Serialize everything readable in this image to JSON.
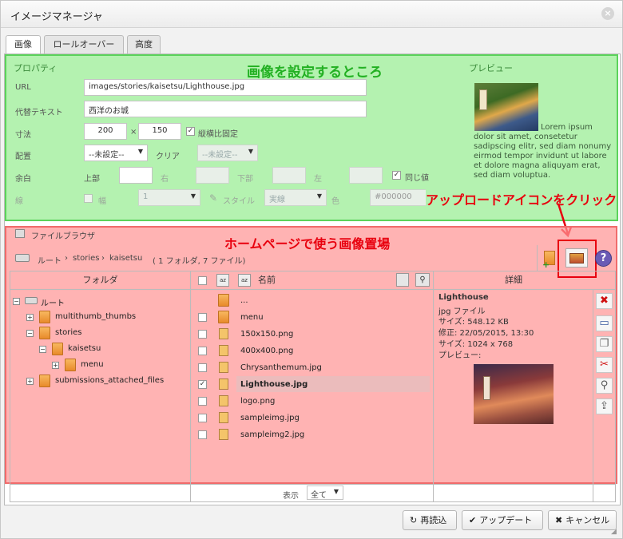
{
  "window": {
    "title": "イメージマネージャ",
    "close_glyph": "×"
  },
  "tabs": [
    {
      "label": "画像",
      "active": true
    },
    {
      "label": "ロールオーバー",
      "active": false
    },
    {
      "label": "高度",
      "active": false
    }
  ],
  "properties": {
    "section": "プロパティ",
    "url_label": "URL",
    "url_value": "images/stories/kaisetsu/Lighthouse.jpg",
    "alt_label": "代替テキスト",
    "alt_value": "西洋のお城",
    "size_label": "寸法",
    "width": "200",
    "times": "×",
    "height": "150",
    "keep_ratio_label": "縦横比固定",
    "keep_ratio_checked": true,
    "align_label": "配置",
    "align_value": "--未設定--",
    "clear_label": "クリア",
    "clear_value": "--未設定--",
    "margin_label": "余白",
    "margin_top": "上部",
    "margin_right": "右",
    "margin_bottom": "下部",
    "margin_left": "左",
    "same_value_label": "同じ値",
    "same_value_checked": true,
    "border_label": "線",
    "border_width_label": "幅",
    "border_width_value": "1",
    "border_style_label": "スタイル",
    "border_style_value": "実線",
    "border_color_label": "色",
    "border_color_value": "#000000"
  },
  "preview": {
    "section": "プレビュー",
    "text": "Lorem ipsum dolor sit amet, consetetur sadipscing elitr, sed diam nonumy eirmod tempor invidunt ut labore et dolore magna aliquyam erat, sed diam voluptua."
  },
  "annotations": {
    "green": "画像を設定するところ",
    "red": "ホームページで使う画像置場",
    "upload": "アップロードアイコンをクリック"
  },
  "browser": {
    "legend": "ファイルブラウザ",
    "breadcrumb_root": "ルート",
    "breadcrumb_sep": "›",
    "breadcrumb_1": "stories",
    "breadcrumb_2": "kaisetsu",
    "breadcrumb_count": "( 1 フォルダ, 7 ファイル)",
    "col_folder": "フォルダ",
    "col_name": "名前",
    "col_details": "詳細",
    "tree": [
      {
        "label": "ルート",
        "expander": "−"
      },
      {
        "label": "multithumb_thumbs",
        "expander": "+"
      },
      {
        "label": "stories",
        "expander": "−"
      },
      {
        "label": "kaisetsu",
        "expander": "−"
      },
      {
        "label": "menu",
        "expander": "+"
      },
      {
        "label": "submissions_attached_files",
        "expander": "+"
      }
    ],
    "files": [
      {
        "name": "...",
        "kind": "up"
      },
      {
        "name": "menu",
        "kind": "folder"
      },
      {
        "name": "150x150.png",
        "kind": "image"
      },
      {
        "name": "400x400.png",
        "kind": "image"
      },
      {
        "name": "Chrysanthemum.jpg",
        "kind": "image"
      },
      {
        "name": "Lighthouse.jpg",
        "kind": "image",
        "selected": true
      },
      {
        "name": "logo.png",
        "kind": "image"
      },
      {
        "name": "sampleimg.jpg",
        "kind": "image"
      },
      {
        "name": "sampleimg2.jpg",
        "kind": "image"
      }
    ],
    "details": {
      "name": "Lighthouse",
      "type": "jpg ファイル",
      "filesize": "サイズ: 548.12 KB",
      "modified": "修正: 22/05/2015, 13:30",
      "dimensions": "サイズ: 1024 x 768",
      "preview_label": "プレビュー:"
    },
    "show_label": "表示",
    "show_value": "全て"
  },
  "buttons": {
    "refresh": "再読込",
    "update": "アップデート",
    "cancel": "キャンセル"
  },
  "colors": {
    "green_overlay": "#b4f2b0",
    "red_overlay": "#ff9696",
    "annotation_red": "#e8000e",
    "annotation_green": "#22b022"
  }
}
